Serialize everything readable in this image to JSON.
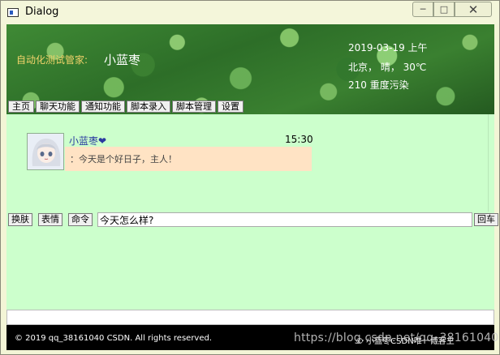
{
  "window": {
    "title": "Dialog",
    "minimize": "─",
    "maximize": "□",
    "close": "✕"
  },
  "header": {
    "assistant_label": "自动化测试管家:",
    "assistant_name": "小蓝枣",
    "date": "2019-03-19 上午",
    "weather": "北京， 晴， 30℃",
    "air": "210 重度污染"
  },
  "menu": [
    "主页",
    "聊天功能",
    "通知功能",
    "脚本录入",
    "脚本管理",
    "设置"
  ],
  "chat": {
    "sender": "小蓝枣❤",
    "time": "15:30",
    "message": "：今天是个好日子，主人！"
  },
  "toolbar": {
    "skin": "换肤",
    "emoji": "表情",
    "command": "命令",
    "input_value": "今天怎么样?",
    "send": "回车"
  },
  "footer": {
    "copyright": "© 2019 qq_38161040 CSDN. All rights reserved.",
    "right_text": "© 小蓝枣CSDN唯一博客主"
  },
  "watermark": "https://blog.csdn.net/qq_38161040",
  "colors": {
    "chat_bg": "#ccffcc",
    "bubble_bg": "#ffe3c4",
    "footer_bg": "#000000",
    "label_yellow": "#f2d36b"
  }
}
